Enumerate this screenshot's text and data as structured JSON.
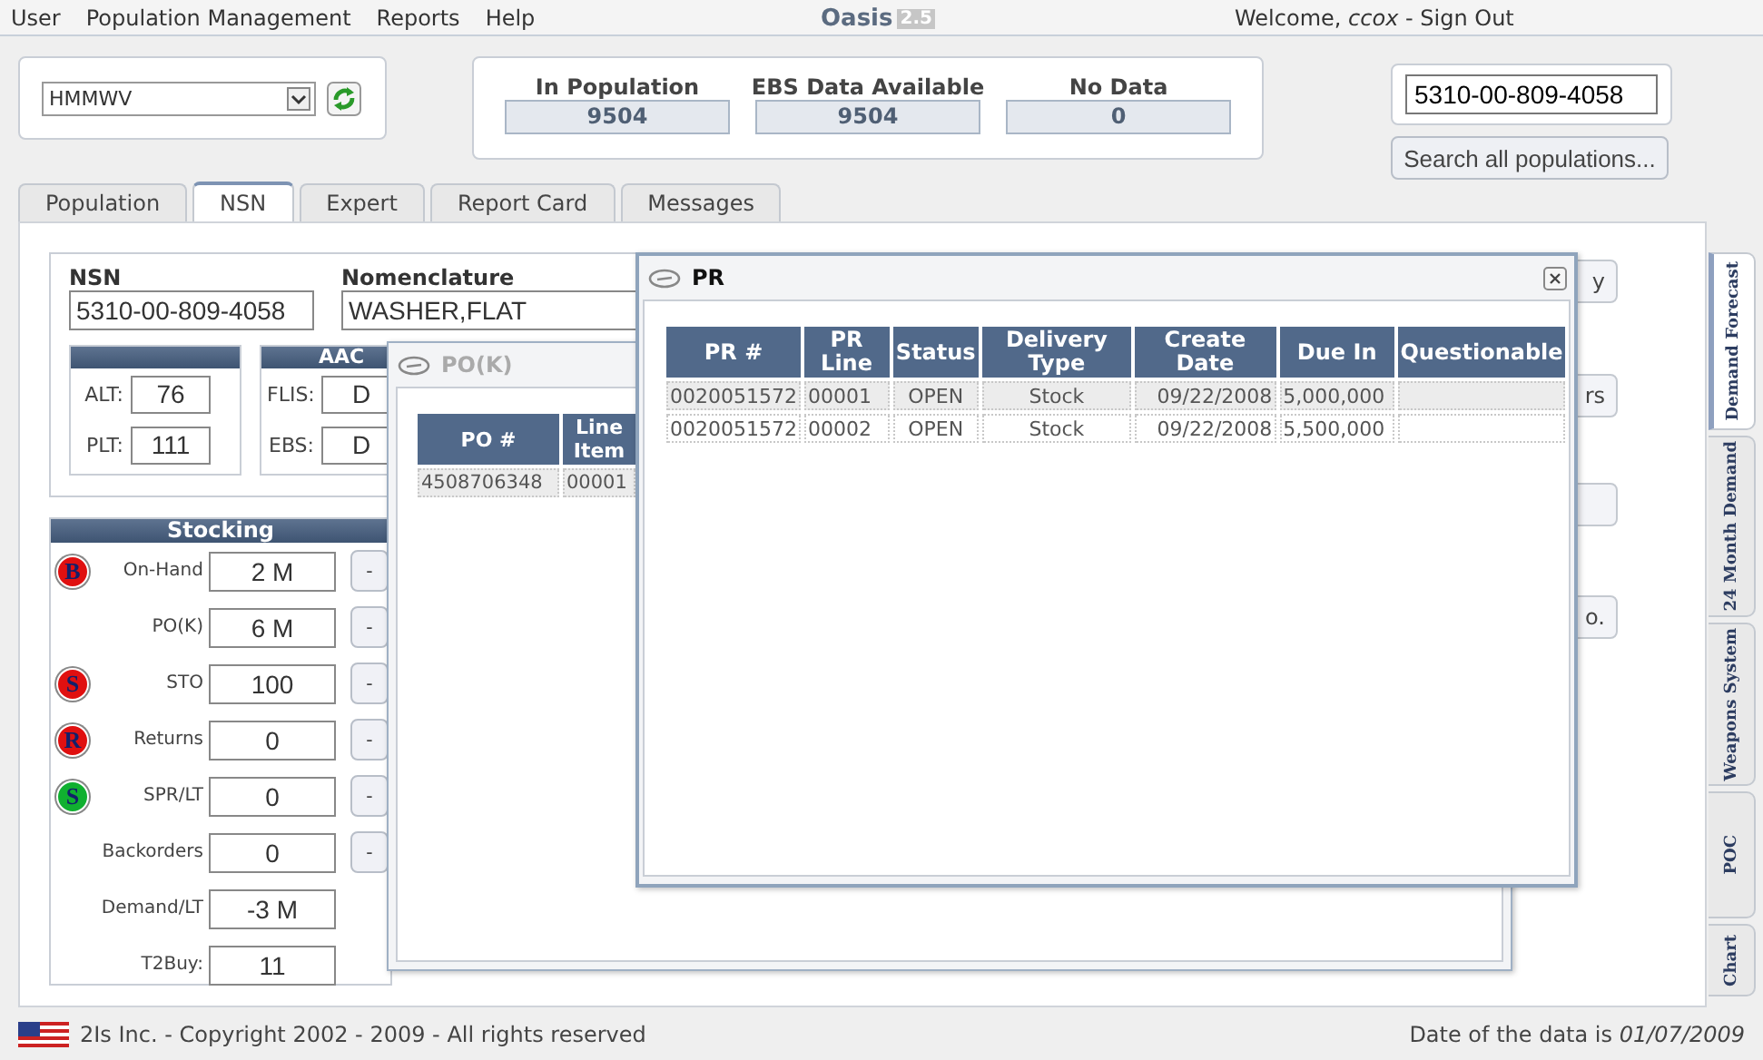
{
  "menu": [
    "User",
    "Population Management",
    "Reports",
    "Help"
  ],
  "logo": {
    "name": "Oasis",
    "version": "2.5"
  },
  "welcome": "Welcome, *ccox* - Sign Out",
  "population_select": {
    "value": "HMMWV"
  },
  "stats": [
    {
      "label": "In Population",
      "value": "9504"
    },
    {
      "label": "EBS Data Available",
      "value": "9504"
    },
    {
      "label": "No Data",
      "value": "0"
    }
  ],
  "search": {
    "value": "5310-00-809-4058",
    "button": "Search all populations..."
  },
  "tabs": [
    {
      "label": "Population",
      "selected": false
    },
    {
      "label": "NSN",
      "selected": true
    },
    {
      "label": "Expert",
      "selected": false
    },
    {
      "label": "Report Card",
      "selected": false
    },
    {
      "label": "Messages",
      "selected": false
    }
  ],
  "nsn": {
    "label": "NSN",
    "value": "5310-00-809-4058"
  },
  "nomenclature": {
    "label": "Nomenclature",
    "value": "WASHER,FLAT"
  },
  "lead_times": [
    {
      "label": "ALT:",
      "value": "76"
    },
    {
      "label": "PLT:",
      "value": "111"
    }
  ],
  "aac": {
    "title": "AAC",
    "fields": [
      {
        "label": "FLIS:",
        "value": "D"
      },
      {
        "label": "EBS:",
        "value": "D"
      }
    ]
  },
  "stocking": {
    "title": "Stocking",
    "rows": [
      {
        "badge": "B",
        "color": "#e01010",
        "label": "On-Hand",
        "value": "2 M",
        "button": "-"
      },
      {
        "label": "PO(K)",
        "value": "6 M",
        "button": "-"
      },
      {
        "badge": "S",
        "color": "#e01010",
        "label": "STO",
        "value": "100",
        "button": "-"
      },
      {
        "badge": "R",
        "color": "#e01010",
        "label": "Returns",
        "value": "0",
        "button": "-"
      },
      {
        "badge": "S",
        "color": "#10b030",
        "label": "SPR/LT",
        "value": "0",
        "button": "-"
      },
      {
        "label": "Backorders",
        "value": "0",
        "button": "-"
      },
      {
        "label": "Demand/LT",
        "value": "-3 M"
      },
      {
        "label": "T2Buy:",
        "value": "11"
      }
    ]
  },
  "side_buttons": [
    {
      "kind": "button",
      "label": "y"
    },
    {
      "kind": "button",
      "label": "rs"
    },
    {
      "kind": "button"
    },
    {
      "kind": "button",
      "label": "o."
    }
  ],
  "pok_window": {
    "title": "PO(K)",
    "active": false,
    "columns": [
      "PO #",
      "Line Item"
    ],
    "rows": [
      [
        "4508706348",
        "00001"
      ]
    ]
  },
  "pr_window": {
    "title": "PR",
    "active": true,
    "columns": [
      "PR #",
      "PR Line",
      "Status",
      "Delivery Type",
      "Create Date",
      "Due In",
      "Questionable"
    ],
    "rows": [
      [
        "0020051572",
        "00001",
        "OPEN",
        "Stock",
        "09/22/2008",
        "5,000,000",
        ""
      ],
      [
        "0020051572",
        "00002",
        "OPEN",
        "Stock",
        "09/22/2008",
        "5,500,000",
        ""
      ]
    ]
  },
  "side_tabs": [
    {
      "label": "Demand Forecast",
      "selected": true
    },
    {
      "label": "24 Month Demand",
      "selected": false
    },
    {
      "label": "Weapons System",
      "selected": false
    },
    {
      "label": "POC",
      "selected": false
    },
    {
      "label": "Chart",
      "selected": false
    }
  ],
  "footer": {
    "copyright": "2Is Inc. - Copyright 2002 - 2009 - All rights reserved",
    "date": "Date of the data is *01/07/2009*"
  }
}
